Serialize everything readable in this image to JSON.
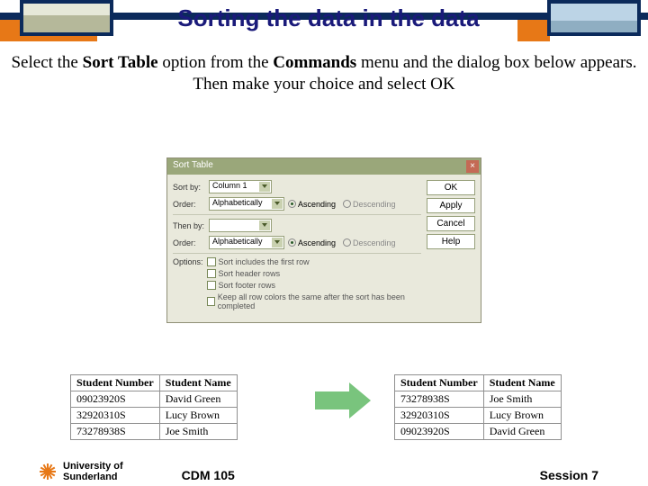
{
  "slide": {
    "title": "Sorting the data in the data",
    "intro_pre": "Select the ",
    "intro_sort": "Sort Table",
    "intro_mid": " option from the ",
    "intro_commands": "Commands",
    "intro_post": " menu and the dialog box below appears.",
    "intro_line3": "Then make your choice and select OK"
  },
  "dialog": {
    "title": "Sort Table",
    "labels": {
      "sortby": "Sort by:",
      "order": "Order:",
      "thenby": "Then by:",
      "options": "Options:"
    },
    "fields": {
      "col": "Column 1",
      "alpha": "Alphabetically",
      "blank": ""
    },
    "radios": {
      "asc": "Ascending",
      "desc": "Descending"
    },
    "options": {
      "o1": "Sort includes the first row",
      "o2": "Sort header rows",
      "o3": "Sort footer rows",
      "o4": "Keep all row colors the same after the sort has been completed"
    },
    "buttons": {
      "ok": "OK",
      "apply": "Apply",
      "cancel": "Cancel",
      "help": "Help"
    }
  },
  "tables": {
    "headers": {
      "num": "Student Number",
      "name": "Student Name"
    },
    "before": [
      {
        "num": "09023920S",
        "name": "David Green"
      },
      {
        "num": "32920310S",
        "name": "Lucy Brown"
      },
      {
        "num": "73278938S",
        "name": "Joe Smith"
      }
    ],
    "after": [
      {
        "num": "73278938S",
        "name": "Joe Smith"
      },
      {
        "num": "32920310S",
        "name": "Lucy Brown"
      },
      {
        "num": "09023920S",
        "name": "David Green"
      }
    ]
  },
  "footer": {
    "uni1": "University of",
    "uni2": "Sunderland",
    "course": "CDM 105",
    "session": "Session 7"
  }
}
